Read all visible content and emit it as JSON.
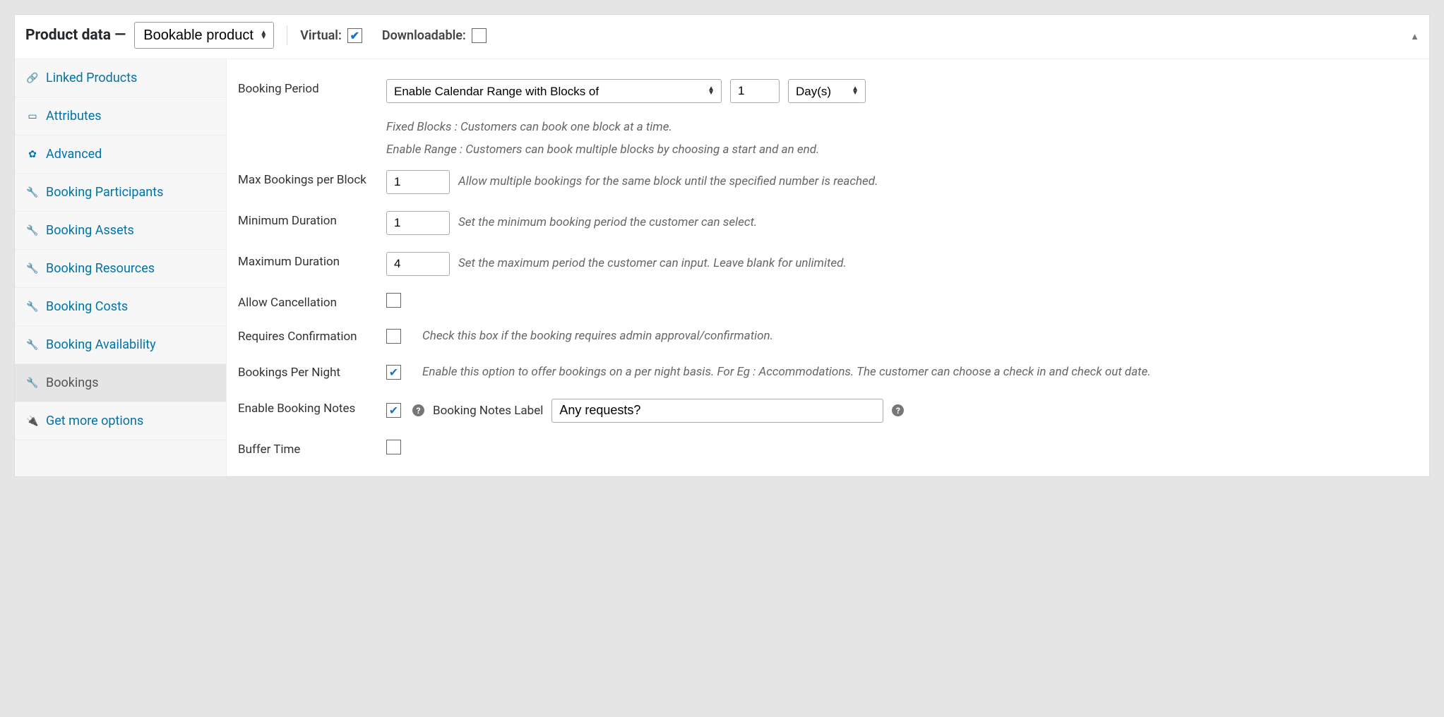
{
  "header": {
    "title": "Product data —",
    "product_type": "Bookable product",
    "virtual_label": "Virtual:",
    "virtual_checked": true,
    "downloadable_label": "Downloadable:",
    "downloadable_checked": false
  },
  "sidebar": {
    "items": [
      {
        "label": "Linked Products",
        "icon": "link",
        "active": false
      },
      {
        "label": "Attributes",
        "icon": "card",
        "active": false
      },
      {
        "label": "Advanced",
        "icon": "gear",
        "active": false
      },
      {
        "label": "Booking Participants",
        "icon": "wrench",
        "active": false
      },
      {
        "label": "Booking Assets",
        "icon": "wrench",
        "active": false
      },
      {
        "label": "Booking Resources",
        "icon": "wrench",
        "active": false
      },
      {
        "label": "Booking Costs",
        "icon": "wrench",
        "active": false
      },
      {
        "label": "Booking Availability",
        "icon": "wrench",
        "active": false
      },
      {
        "label": "Bookings",
        "icon": "wrench",
        "active": true
      },
      {
        "label": "Get more options",
        "icon": "plug",
        "active": false
      }
    ]
  },
  "form": {
    "booking_period_label": "Booking Period",
    "booking_period_mode": "Enable Calendar Range with Blocks of",
    "booking_period_qty": "1",
    "booking_period_unit": "Day(s)",
    "booking_period_help1": "Fixed Blocks : Customers can book one block at a time.",
    "booking_period_help2": "Enable Range : Customers can book multiple blocks by choosing a start and an end.",
    "max_bookings_label": "Max Bookings per Block",
    "max_bookings_value": "1",
    "max_bookings_help": "Allow multiple bookings for the same block until the specified number is reached.",
    "min_duration_label": "Minimum Duration",
    "min_duration_value": "1",
    "min_duration_help": "Set the minimum booking period the customer can select.",
    "max_duration_label": "Maximum Duration",
    "max_duration_value": "4",
    "max_duration_help": "Set the maximum period the customer can input. Leave blank for unlimited.",
    "allow_cancel_label": "Allow Cancellation",
    "allow_cancel_checked": false,
    "requires_conf_label": "Requires Confirmation",
    "requires_conf_checked": false,
    "requires_conf_help": "Check this box if the booking requires admin approval/confirmation.",
    "per_night_label": "Bookings Per Night",
    "per_night_checked": true,
    "per_night_help": "Enable this option to offer bookings on a per night basis. For Eg : Accommodations. The customer can choose a check in and check out date.",
    "enable_notes_label": "Enable Booking Notes",
    "enable_notes_checked": true,
    "notes_field_label": "Booking Notes Label",
    "notes_field_value": "Any requests?",
    "buffer_time_label": "Buffer Time",
    "buffer_time_checked": false
  }
}
